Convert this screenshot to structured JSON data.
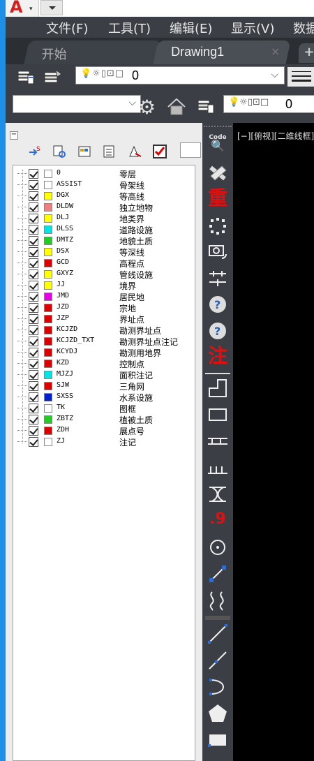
{
  "menu": [
    "文件(F)",
    "工具(T)",
    "编辑(E)",
    "显示(V)",
    "数据"
  ],
  "tabs": {
    "start": "开始",
    "drawing": "Drawing1",
    "close_glyph": "×",
    "add_glyph": "+"
  },
  "toolbar": {
    "current_layer": "0",
    "current_layer_2": "0"
  },
  "palette": {
    "code_label": "Code",
    "heavy_label": "重",
    "note_label": "注",
    "elev_label": ".9"
  },
  "view_label": "[−][俯视][二维线框]",
  "layers": [
    {
      "code": "0",
      "desc": "零层",
      "color": "#ffffff"
    },
    {
      "code": "ASSIST",
      "desc": "骨架线",
      "color": "#ffffff"
    },
    {
      "code": "DGX",
      "desc": "等高线",
      "color": "#ffff00"
    },
    {
      "code": "DLDW",
      "desc": "独立地物",
      "color": "#f08080"
    },
    {
      "code": "DLJ",
      "desc": "地类界",
      "color": "#ffff00"
    },
    {
      "code": "DLSS",
      "desc": "道路设施",
      "color": "#00e5e5"
    },
    {
      "code": "DMTZ",
      "desc": "地貌土质",
      "color": "#22cc22"
    },
    {
      "code": "DSX",
      "desc": "等深线",
      "color": "#ffff00"
    },
    {
      "code": "GCD",
      "desc": "高程点",
      "color": "#dd0000"
    },
    {
      "code": "GXYZ",
      "desc": "管线设施",
      "color": "#ffff00"
    },
    {
      "code": "JJ",
      "desc": "境界",
      "color": "#ffff00"
    },
    {
      "code": "JMD",
      "desc": "居民地",
      "color": "#e600e6"
    },
    {
      "code": "JZD",
      "desc": "宗地",
      "color": "#dd0000"
    },
    {
      "code": "JZP",
      "desc": "界址点",
      "color": "#dd0000"
    },
    {
      "code": "KCJZD",
      "desc": "勘测界址点",
      "color": "#dd0000"
    },
    {
      "code": "KCJZD_TXT",
      "desc": "勘测界址点注记",
      "color": "#dd0000"
    },
    {
      "code": "KCYDJ",
      "desc": "勘测用地界",
      "color": "#dd0000"
    },
    {
      "code": "KZD",
      "desc": "控制点",
      "color": "#dd0000"
    },
    {
      "code": "MJZJ",
      "desc": "面积注记",
      "color": "#00e5e5"
    },
    {
      "code": "SJW",
      "desc": "三角网",
      "color": "#dd0000"
    },
    {
      "code": "SXSS",
      "desc": "水系设施",
      "color": "#0022cc"
    },
    {
      "code": "TK",
      "desc": "图框",
      "color": "#ffffff"
    },
    {
      "code": "ZBTZ",
      "desc": "植被土质",
      "color": "#22cc22"
    },
    {
      "code": "ZDH",
      "desc": "展点号",
      "color": "#dd0000"
    },
    {
      "code": "ZJ",
      "desc": "注记",
      "color": "#ffffff"
    }
  ]
}
